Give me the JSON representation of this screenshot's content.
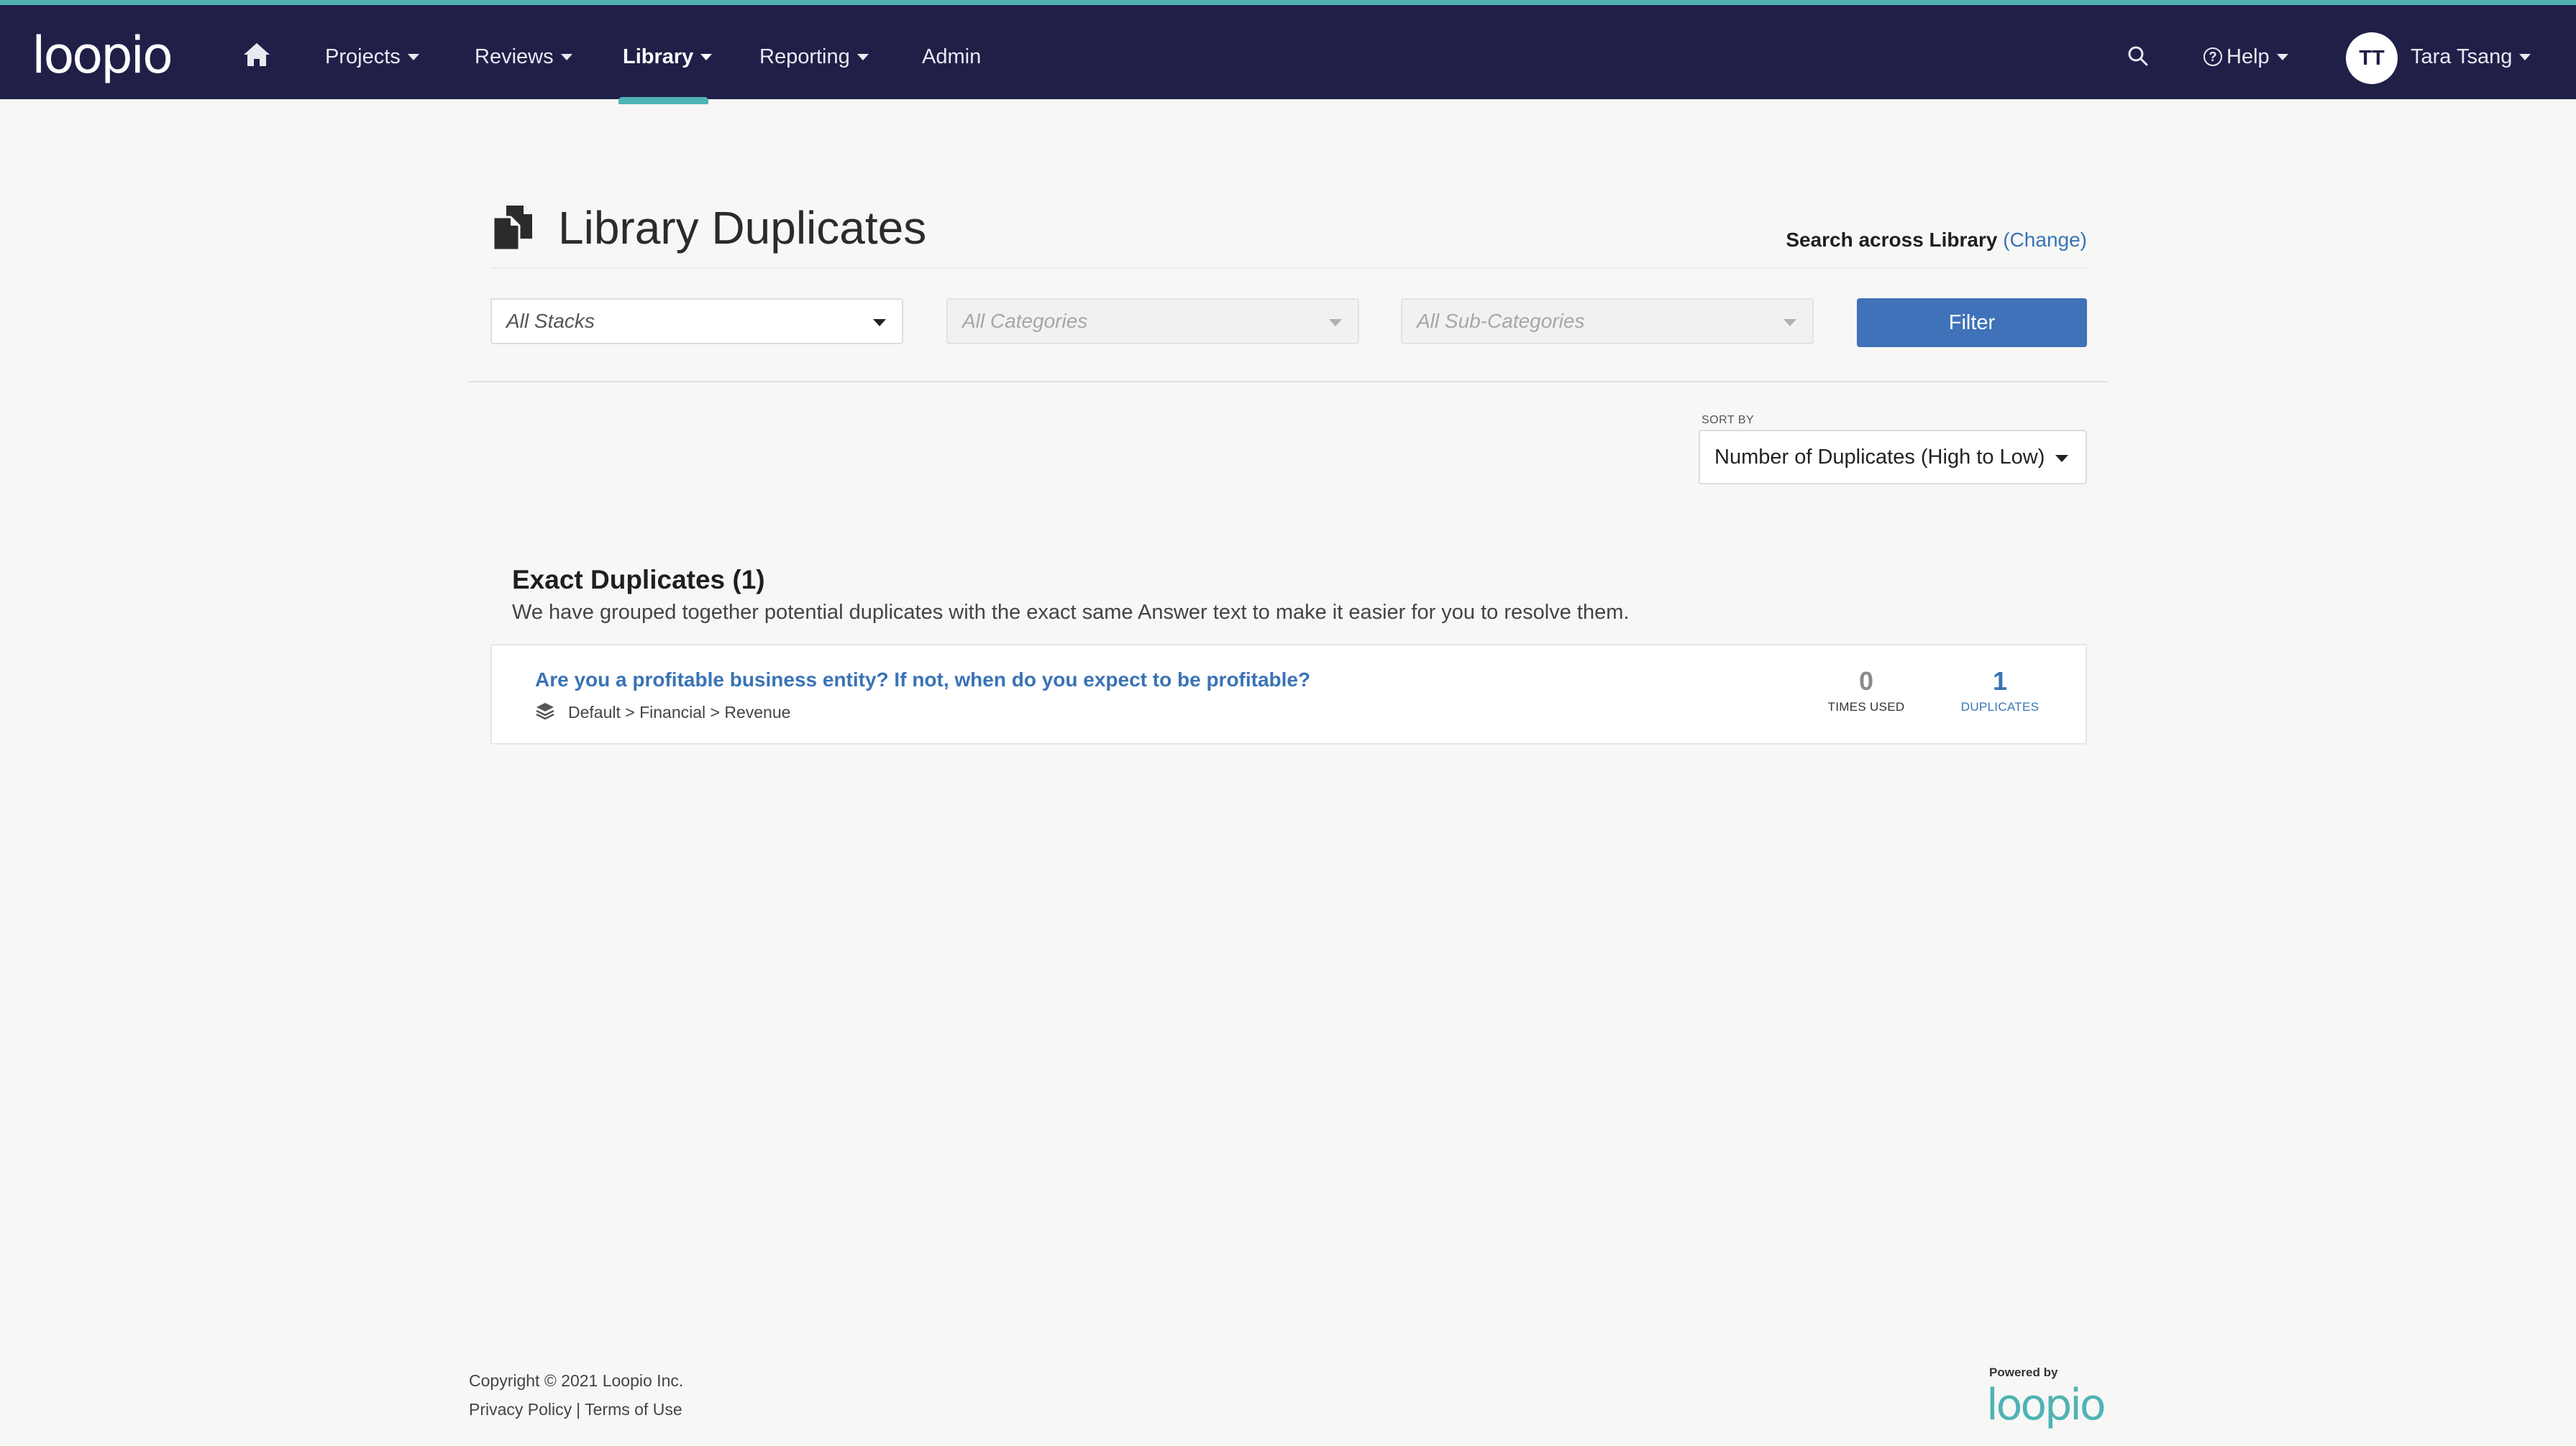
{
  "nav": {
    "logo": "loopio",
    "items": [
      {
        "label": "Projects"
      },
      {
        "label": "Reviews"
      },
      {
        "label": "Library"
      },
      {
        "label": "Reporting"
      },
      {
        "label": "Admin"
      }
    ],
    "help_label": "Help",
    "user_initials": "TT",
    "user_name": "Tara Tsang",
    "accent_color": "#4fb3b3",
    "bg_color": "#201f48"
  },
  "page": {
    "title": "Library Duplicates",
    "search_scope_label": "Search across Library",
    "search_scope_change": "(Change)"
  },
  "filters": {
    "stacks_placeholder": "All Stacks",
    "categories_placeholder": "All Categories",
    "subcategories_placeholder": "All Sub-Categories",
    "filter_button": "Filter"
  },
  "sort": {
    "label": "SORT BY",
    "value": "Number of Duplicates (High to Low)"
  },
  "exact_duplicates": {
    "title": "Exact Duplicates (1)",
    "description": "We have grouped together potential duplicates with the exact same Answer text to make it easier for you to resolve them.",
    "items": [
      {
        "question": "Are you a profitable business entity? If not, when do you expect to be profitable?",
        "path": "Default > Financial > Revenue",
        "times_used": "0",
        "times_used_label": "TIMES USED",
        "duplicates": "1",
        "duplicates_label": "DUPLICATES"
      }
    ]
  },
  "footer": {
    "copyright": "Copyright © 2021 Loopio Inc.",
    "privacy": "Privacy Policy",
    "separator": "|",
    "terms": "Terms of Use",
    "powered_by": "Powered by",
    "powered_logo": "loopio"
  }
}
